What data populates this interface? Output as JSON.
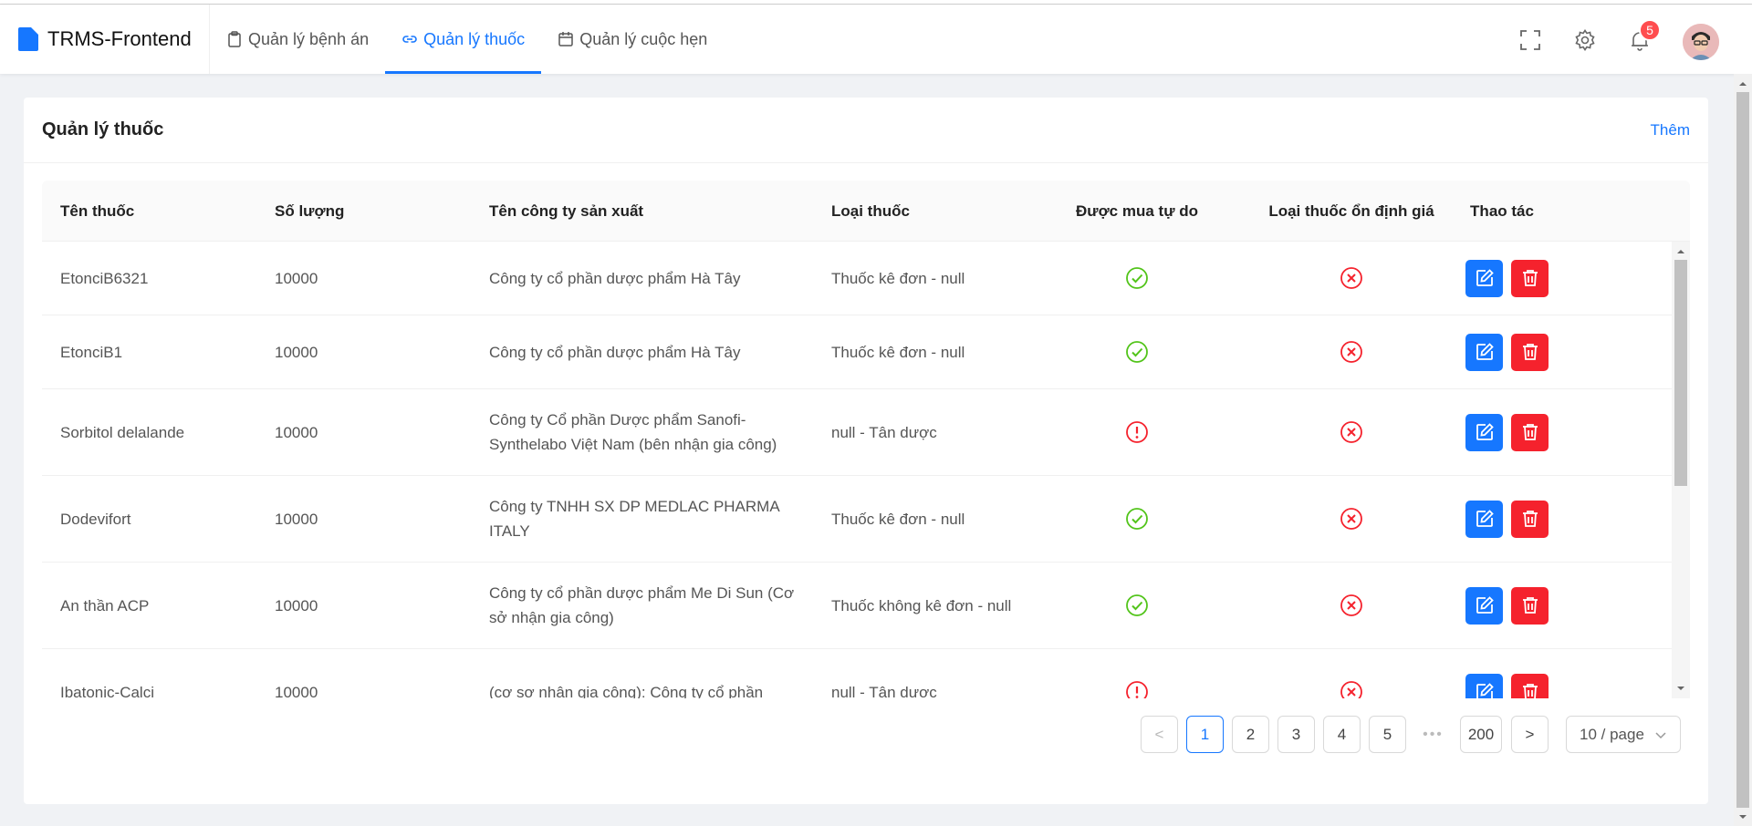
{
  "app": {
    "title": "TRMS-Frontend"
  },
  "nav": {
    "items": [
      {
        "label": "Quản lý bệnh án",
        "icon": "clipboard-icon",
        "active": false
      },
      {
        "label": "Quản lý thuốc",
        "icon": "link-icon",
        "active": true
      },
      {
        "label": "Quản lý cuộc hẹn",
        "icon": "calendar-icon",
        "active": false
      }
    ]
  },
  "header_actions": {
    "notifications_count": "5"
  },
  "card": {
    "title": "Quản lý thuốc",
    "add_label": "Thêm"
  },
  "table": {
    "columns": [
      "Tên thuốc",
      "Số lượng",
      "Tên công ty sản xuất",
      "Loại thuốc",
      "Được mua tự do",
      "Loại thuốc ổn định giá",
      "Thao tác"
    ],
    "rows": [
      {
        "name": "EtonciB6321",
        "qty": "10000",
        "company": "Công ty cổ phần dược phẩm Hà Tây",
        "type": "Thuốc kê đơn - null",
        "free": "yes",
        "stable": "no"
      },
      {
        "name": "EtonciB1",
        "qty": "10000",
        "company": "Công ty cổ phần dược phẩm Hà Tây",
        "type": "Thuốc kê đơn - null",
        "free": "yes",
        "stable": "no"
      },
      {
        "name": "Sorbitol delalande",
        "qty": "10000",
        "company": "Công ty Cổ phần Dược phẩm Sanofi-Synthelabo Việt Nam (bên nhận gia công)",
        "type": "null - Tân dược",
        "free": "warn",
        "stable": "no"
      },
      {
        "name": "Dodevifort",
        "qty": "10000",
        "company": "Công ty TNHH SX DP MEDLAC PHARMA ITALY",
        "type": "Thuốc kê đơn - null",
        "free": "yes",
        "stable": "no"
      },
      {
        "name": "An thần ACP",
        "qty": "10000",
        "company": "Công ty cổ phần dược phẩm Me Di Sun (Cơ sở nhận gia công)",
        "type": "Thuốc không kê đơn - null",
        "free": "yes",
        "stable": "no"
      },
      {
        "name": "Ibatonic-Calci",
        "qty": "10000",
        "company": "(cơ sơ nhận gia công): Công ty cổ phần",
        "type": "null - Tân dược",
        "free": "warn",
        "stable": "no"
      }
    ]
  },
  "pagination": {
    "prev": "<",
    "pages": [
      "1",
      "2",
      "3",
      "4",
      "5"
    ],
    "ellipsis": "•••",
    "last": "200",
    "next": ">",
    "current": "1",
    "page_size": "10 / page"
  },
  "colors": {
    "primary": "#1677ff",
    "danger": "#f5222d",
    "success": "#52c41a",
    "error": "#f5222d"
  }
}
